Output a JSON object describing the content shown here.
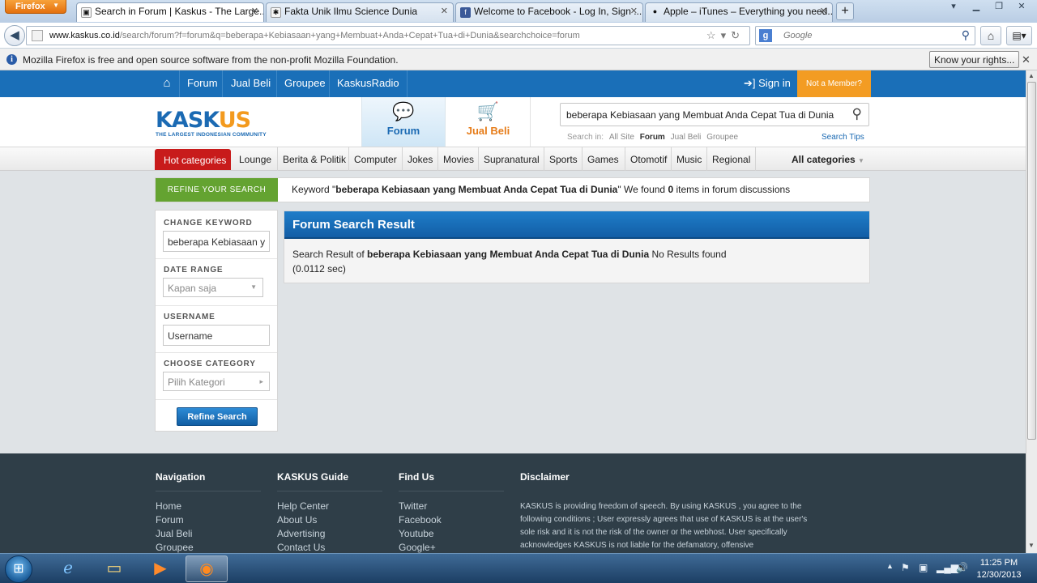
{
  "browser": {
    "app_button": "Firefox",
    "tabs": [
      {
        "title": "Search in Forum | Kaskus - The Large...",
        "active": true,
        "favicon": "kaskus-favicon-icon"
      },
      {
        "title": "Fakta Unik Ilmu Science Dunia",
        "active": false,
        "favicon": "generic-favicon-icon"
      },
      {
        "title": "Welcome to Facebook - Log In, Sign ...",
        "active": false,
        "favicon": "facebook-favicon-icon"
      },
      {
        "title": "Apple – iTunes – Everything you need...",
        "active": false,
        "favicon": "apple-favicon-icon"
      }
    ],
    "url_domain": "www.kaskus.co.id",
    "url_path": "/search/forum?f=forum&q=beberapa+Kebiasaan+yang+Membuat+Anda+Cepat+Tua+di+Dunia&searchchoice=forum",
    "search_placeholder": "Google",
    "notice": "Mozilla Firefox is free and open source software from the non-profit Mozilla Foundation.",
    "notice_button": "Know your rights..."
  },
  "site": {
    "topnav": [
      "Forum",
      "Jual Beli",
      "Groupee",
      "KaskusRadio"
    ],
    "signin": "Sign in",
    "not_member": "Not a Member?",
    "logo_word_a": "KASK",
    "logo_word_b": "US",
    "logo_tagline": "THE LARGEST INDONESIAN COMMUNITY",
    "section_forum": "Forum",
    "section_jualbeli": "Jual Beli",
    "search_keyword": "beberapa Kebiasaan yang Membuat Anda Cepat Tua di Dunia",
    "search_in_label": "Search in:",
    "search_in": [
      "All Site",
      "Forum",
      "Jual Beli",
      "Groupee"
    ],
    "search_tips": "Search Tips",
    "hot_categories": "Hot categories",
    "categories": [
      "Lounge",
      "Berita & Politik",
      "Computer",
      "Jokes",
      "Movies",
      "Supranatural",
      "Sports",
      "Games",
      "Otomotif",
      "Music",
      "Regional"
    ],
    "all_categories": "All categories"
  },
  "refine": {
    "label": "REFINE YOUR SEARCH",
    "msg_a": "Keyword \"",
    "keyword": "beberapa Kebiasaan yang Membuat Anda Cepat Tua di Dunia",
    "msg_b": "\" We found ",
    "count": "0",
    "msg_c": " items in forum discussions"
  },
  "sidebar": {
    "change_keyword_label": "CHANGE KEYWORD",
    "keyword_value": "beberapa Kebiasaan y",
    "date_range_label": "DATE RANGE",
    "date_range_value": "Kapan saja",
    "username_label": "USERNAME",
    "username_value": "Username",
    "category_label": "CHOOSE CATEGORY",
    "category_value": "Pilih Kategori",
    "refine_button": "Refine Search"
  },
  "results": {
    "title": "Forum Search Result",
    "prefix": "Search Result of ",
    "keyword": "beberapa Kebiasaan yang Membuat Anda Cepat Tua di Dunia",
    "suffix": " No Results found",
    "time": "(0.0112 sec)"
  },
  "footer": {
    "navigation": {
      "title": "Navigation",
      "links": [
        "Home",
        "Forum",
        "Jual Beli",
        "Groupee"
      ]
    },
    "guide": {
      "title": "KASKUS Guide",
      "links": [
        "Help Center",
        "About Us",
        "Advertising",
        "Contact Us"
      ]
    },
    "findus": {
      "title": "Find Us",
      "links": [
        "Twitter",
        "Facebook",
        "Youtube",
        "Google+"
      ]
    },
    "disclaimer": {
      "title": "Disclaimer",
      "text": "KASKUS is providing freedom of speech. By using KASKUS , you agree to the following conditions ; User expressly agrees that use of KASKUS is at the user's sole risk and it is not the risk of the owner or the webhost. User specifically acknowledges KASKUS is not liable for the defamatory, offensive"
    }
  },
  "taskbar": {
    "time": "11:25 PM",
    "date": "12/30/2013"
  },
  "colors": {
    "kaskus_blue": "#1a6fb8",
    "kaskus_orange": "#f39c23",
    "hot_red": "#c81b1b",
    "refine_green": "#64a331",
    "footer_bg": "#2f3e48"
  }
}
